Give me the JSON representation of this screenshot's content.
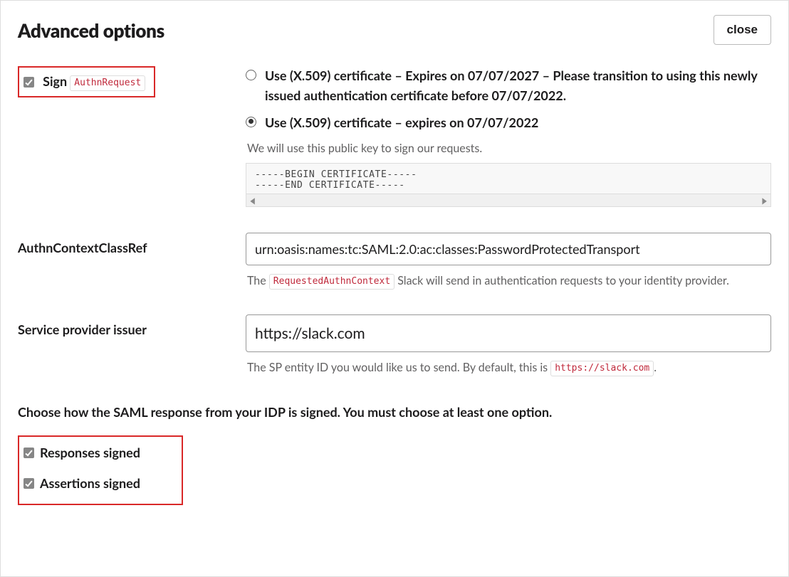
{
  "header": {
    "title": "Advanced options",
    "close_label": "close"
  },
  "sign": {
    "checkbox_label": "Sign",
    "code": "AuthnRequest",
    "radios": [
      {
        "selected": false,
        "label": "Use (X.509) certificate – Expires on 07/07/2027 – Please transition to using this newly issued authentication certificate before 07/07/2022."
      },
      {
        "selected": true,
        "label": "Use (X.509) certificate – expires on 07/07/2022"
      }
    ],
    "hint": "We will use this public key to sign our requests.",
    "cert_text": "-----BEGIN CERTIFICATE-----\n-----END CERTIFICATE-----"
  },
  "authn_class": {
    "label": "AuthnContextClassRef",
    "value": "urn:oasis:names:tc:SAML:2.0:ac:classes:PasswordProtectedTransport",
    "hint_pre": "The ",
    "hint_code": "RequestedAuthnContext",
    "hint_post": " Slack will send in authentication requests to your identity provider."
  },
  "sp_issuer": {
    "label": "Service provider issuer",
    "value": "https://slack.com",
    "hint_pre": "The SP entity ID you would like us to send. By default, this is ",
    "hint_code": "https://slack.com",
    "hint_post": "."
  },
  "signing": {
    "note": "Choose how the SAML response from your IDP is signed. You must choose at least one option.",
    "responses_label": "Responses signed",
    "assertions_label": "Assertions signed"
  }
}
